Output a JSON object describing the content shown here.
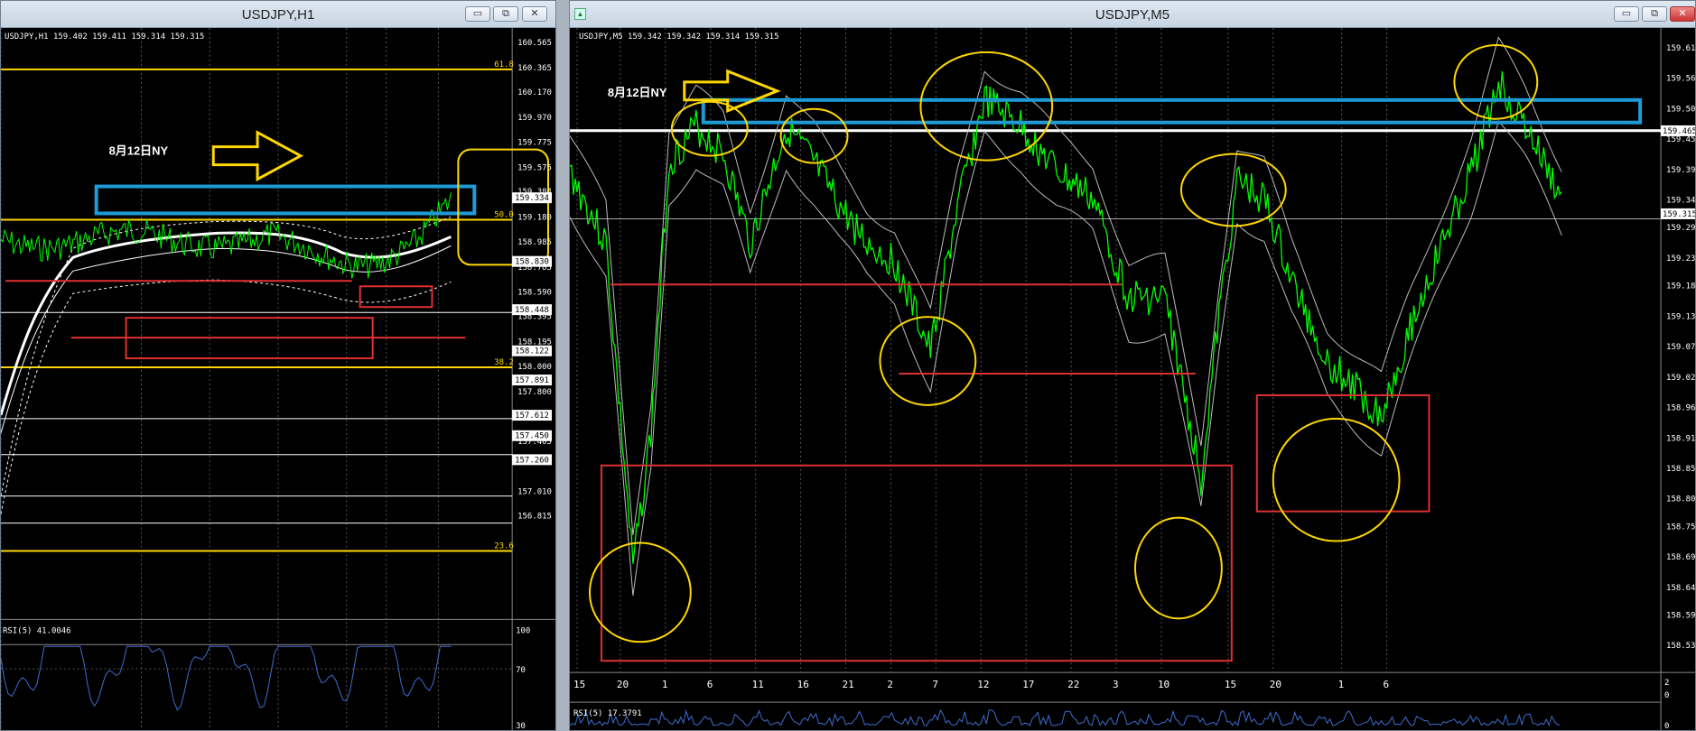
{
  "left_window": {
    "title": "USDJPY,H1",
    "ohlc": "USDJPY,H1  159.402 159.411 159.314 159.315",
    "price_axis": [
      "160.565",
      "160.365",
      "160.170",
      "159.970",
      "159.775",
      "159.575",
      "159.384",
      "159.334",
      "159.180",
      "158.985",
      "158.830",
      "158.785",
      "158.590",
      "158.448",
      "158.395",
      "158.195",
      "158.122",
      "158.000",
      "157.891",
      "157.800",
      "157.612",
      "157.450",
      "157.405",
      "157.260",
      "157.010",
      "156.815"
    ],
    "price_boxes": [
      "159.334",
      "158.830",
      "158.448",
      "158.122",
      "157.891",
      "157.612",
      "157.450",
      "157.260"
    ],
    "fib_levels": [
      "61.8",
      "50.0",
      "38.2",
      "23.6"
    ],
    "annotation_text": "8月12日NY",
    "rsi_label": "RSI(5) 41.0046",
    "rsi_ticks": [
      "100",
      "70",
      "30"
    ]
  },
  "right_window": {
    "title": "USDJPY,M5",
    "ohlc": "USDJPY,M5  159.342 159.342 159.314 159.315",
    "price_axis": [
      "159.615",
      "159.560",
      "159.505",
      "159.450",
      "159.395",
      "159.340",
      "159.290",
      "159.235",
      "159.185",
      "159.130",
      "159.075",
      "159.020",
      "158.965",
      "158.910",
      "158.855",
      "158.800",
      "158.750",
      "158.695",
      "158.640",
      "158.590",
      "158.535"
    ],
    "price_boxes": [
      "159.465",
      "159.315"
    ],
    "time_axis": [
      "15",
      "20",
      "1",
      "6",
      "11",
      "16",
      "21",
      "2",
      "7",
      "12",
      "17",
      "22",
      "3",
      "10",
      "15",
      "20",
      "1",
      "6"
    ],
    "annotation_text": "8月12日NY",
    "rsi_label": "RSI(5) 17.3791",
    "rsi_ticks": [
      "2",
      "0",
      "0"
    ]
  },
  "window_buttons": {
    "minimize": "▭",
    "restore": "⧉",
    "close": "✕"
  },
  "colors": {
    "candles": "#00ff00",
    "fib": "#ffd700",
    "support": "#e03030",
    "resistance": "#1e9bd7",
    "ellipse": "#ffd700",
    "rsi": "#3d6ecf",
    "bands": "#ffffff"
  }
}
